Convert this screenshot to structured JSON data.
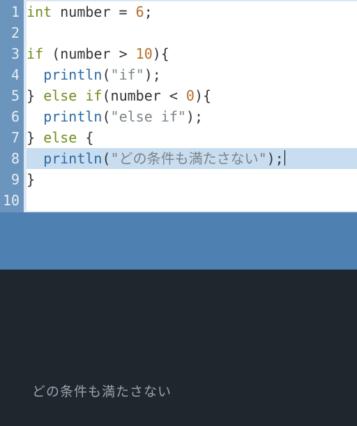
{
  "editor": {
    "highlighted_line": 8,
    "cursor": {
      "line": 8,
      "after_token": "line8_t6"
    },
    "lines": [
      {
        "n": 1,
        "tokens": [
          {
            "t": "int",
            "c": "kw"
          },
          {
            "t": " ",
            "c": ""
          },
          {
            "t": "number",
            "c": "id"
          },
          {
            "t": " = ",
            "c": "op"
          },
          {
            "t": "6",
            "c": "num"
          },
          {
            "t": ";",
            "c": "punc"
          }
        ]
      },
      {
        "n": 2,
        "tokens": []
      },
      {
        "n": 3,
        "tokens": [
          {
            "t": "if",
            "c": "kw"
          },
          {
            "t": " (",
            "c": "punc"
          },
          {
            "t": "number",
            "c": "id"
          },
          {
            "t": " > ",
            "c": "op"
          },
          {
            "t": "10",
            "c": "num"
          },
          {
            "t": "){",
            "c": "punc"
          }
        ]
      },
      {
        "n": 4,
        "tokens": [
          {
            "t": "  ",
            "c": ""
          },
          {
            "t": "println",
            "c": "fn"
          },
          {
            "t": "(",
            "c": "punc"
          },
          {
            "t": "\"if\"",
            "c": "str"
          },
          {
            "t": ");",
            "c": "punc"
          }
        ]
      },
      {
        "n": 5,
        "tokens": [
          {
            "t": "} ",
            "c": "punc"
          },
          {
            "t": "else if",
            "c": "kw"
          },
          {
            "t": "(",
            "c": "punc"
          },
          {
            "t": "number",
            "c": "id"
          },
          {
            "t": " < ",
            "c": "op"
          },
          {
            "t": "0",
            "c": "num"
          },
          {
            "t": "){",
            "c": "punc"
          }
        ]
      },
      {
        "n": 6,
        "tokens": [
          {
            "t": "  ",
            "c": ""
          },
          {
            "t": "println",
            "c": "fn"
          },
          {
            "t": "(",
            "c": "punc"
          },
          {
            "t": "\"else if\"",
            "c": "str"
          },
          {
            "t": ");",
            "c": "punc"
          }
        ]
      },
      {
        "n": 7,
        "tokens": [
          {
            "t": "} ",
            "c": "punc"
          },
          {
            "t": "else",
            "c": "kw"
          },
          {
            "t": " {",
            "c": "punc"
          }
        ]
      },
      {
        "n": 8,
        "tokens": [
          {
            "t": "  ",
            "c": ""
          },
          {
            "t": "println",
            "c": "fn"
          },
          {
            "t": "(",
            "c": "punc"
          },
          {
            "t": "\"どの条件も満たさない\"",
            "c": "str"
          },
          {
            "t": ");",
            "c": "punc"
          }
        ]
      },
      {
        "n": 9,
        "tokens": [
          {
            "t": "}",
            "c": "punc"
          }
        ]
      },
      {
        "n": 10,
        "tokens": []
      }
    ]
  },
  "console": {
    "output": "どの条件も満たさない"
  },
  "colors": {
    "gutter_bg": "#6b95bc",
    "divider_bg": "#4f80b2",
    "console_bg": "#1f272e",
    "highlight_bg": "#c8ddf0"
  }
}
